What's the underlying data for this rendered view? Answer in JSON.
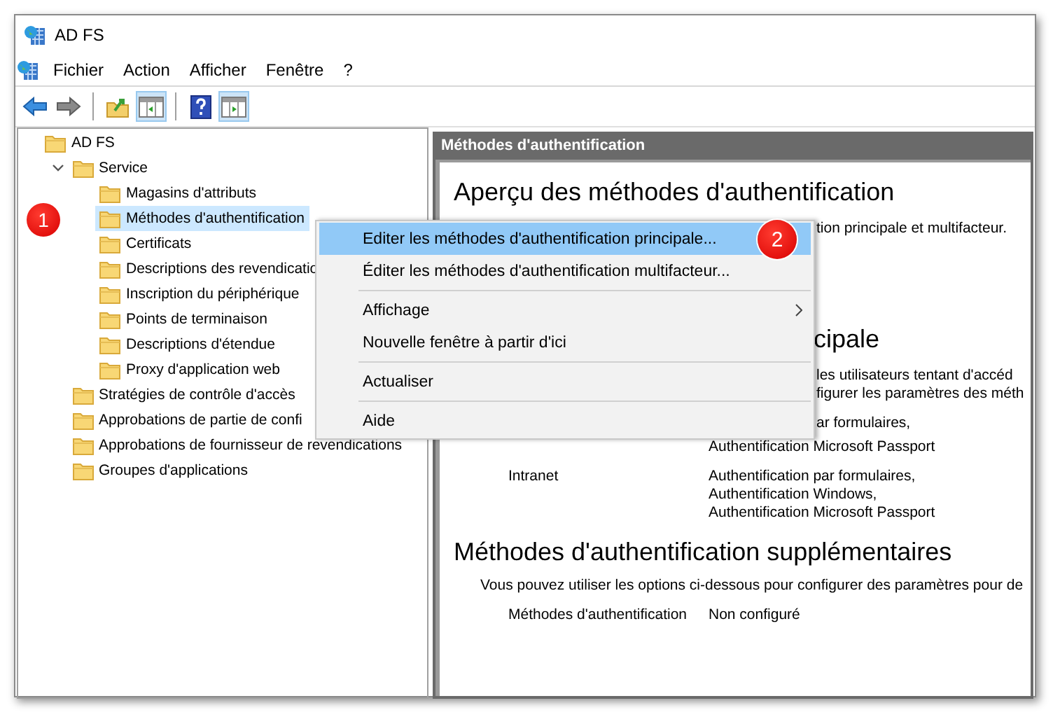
{
  "window": {
    "title": "AD FS"
  },
  "menu_bar": [
    "Fichier",
    "Action",
    "Afficher",
    "Fenêtre",
    "?"
  ],
  "toolbar": [
    {
      "kind": "back",
      "pressed": false
    },
    {
      "kind": "forward",
      "pressed": false
    },
    {
      "kind": "separator"
    },
    {
      "kind": "up",
      "pressed": false
    },
    {
      "kind": "tree_pane",
      "pressed": true
    },
    {
      "kind": "separator"
    },
    {
      "kind": "help",
      "pressed": false
    },
    {
      "kind": "action_pane",
      "pressed": true
    }
  ],
  "tree": [
    {
      "label": "AD FS",
      "selected": false,
      "children": [
        {
          "label": "Service",
          "selected": false,
          "expanded": true,
          "children": [
            {
              "label": "Magasins d'attributs",
              "selected": false
            },
            {
              "label": "Méthodes d'authentification",
              "selected": true,
              "callout": "1"
            },
            {
              "label": "Certificats",
              "selected": false
            },
            {
              "label": "Descriptions des revendicatio",
              "selected": false
            },
            {
              "label": "Inscription du périphérique",
              "selected": false
            },
            {
              "label": "Points de terminaison",
              "selected": false
            },
            {
              "label": "Descriptions d'étendue",
              "selected": false
            },
            {
              "label": "Proxy d'application web",
              "selected": false
            }
          ]
        },
        {
          "label": "Stratégies de contrôle d'accès",
          "selected": false
        },
        {
          "label": "Approbations de partie de confi",
          "selected": false
        },
        {
          "label": "Approbations de fournisseur de revendications",
          "selected": false
        },
        {
          "label": "Groupes d'applications",
          "selected": false
        }
      ]
    }
  ],
  "context_menu": [
    {
      "kind": "item",
      "label": "Editer les méthodes d'authentification principale...",
      "selected": true,
      "callout": "2"
    },
    {
      "kind": "item",
      "label": "Éditer les méthodes d'authentification multifacteur...",
      "selected": false
    },
    {
      "kind": "separator"
    },
    {
      "kind": "submenu",
      "label": "Affichage",
      "selected": false
    },
    {
      "kind": "item",
      "label": "Nouvelle fenêtre à partir d'ici",
      "selected": false
    },
    {
      "kind": "separator"
    },
    {
      "kind": "item",
      "label": "Actualiser",
      "selected": false
    },
    {
      "kind": "separator"
    },
    {
      "kind": "item",
      "label": "Aide",
      "selected": false
    }
  ],
  "content": {
    "header": "Méthodes d'authentification",
    "blocks": [
      {
        "kind": "heading",
        "text": "Aperçu des méthodes d'authentification"
      },
      {
        "kind": "text_fragment",
        "lines": [
          "tion principale et multifacteur."
        ]
      },
      {
        "kind": "heading_fragment",
        "text": "cipale"
      },
      {
        "kind": "text_fragment",
        "lines": [
          "les utilisateurs tentant d'accéd",
          "figurer les paramètres des méth"
        ]
      },
      {
        "kind": "text_fragment",
        "lines": [
          "ar formulaires,"
        ]
      },
      {
        "kind": "value",
        "lines": [
          "Authentification Microsoft Passport"
        ]
      },
      {
        "kind": "pair",
        "label": "Intranet",
        "lines": [
          "Authentification par formulaires,",
          "Authentification Windows,",
          "Authentification Microsoft Passport"
        ]
      },
      {
        "kind": "heading",
        "text": "Méthodes d'authentification supplémentaires"
      },
      {
        "kind": "paragraph",
        "text": "Vous pouvez utiliser les options ci-dessous pour configurer des paramètres pour de"
      },
      {
        "kind": "pair",
        "label": "Méthodes d'authentification",
        "lines": [
          "Non configuré"
        ]
      }
    ]
  }
}
